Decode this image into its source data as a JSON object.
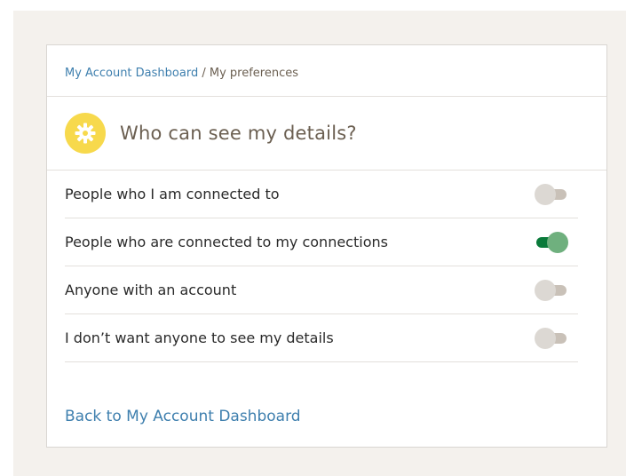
{
  "breadcrumb": {
    "dashboard_link": "My Account Dashboard",
    "separator": " / ",
    "current": "My preferences"
  },
  "header": {
    "icon": "gear-icon",
    "title": "Who can see my details?"
  },
  "options": [
    {
      "label": "People who I am connected to",
      "enabled": false
    },
    {
      "label": "People who are connected to my connections",
      "enabled": true
    },
    {
      "label": "Anyone with an account",
      "enabled": false
    },
    {
      "label": "I don’t want anyone to see my details",
      "enabled": false
    }
  ],
  "footer": {
    "back_link": "Back to My Account Dashboard"
  },
  "colors": {
    "accent_link": "#3e7fae",
    "badge_yellow": "#f7d94c",
    "toggle_on": "#0a7a3a",
    "toggle_on_knob": "#6fb07e",
    "toggle_off_track": "#c9c1b8",
    "toggle_off_knob": "#dcd8d3",
    "page_background": "#f4f1ed"
  }
}
